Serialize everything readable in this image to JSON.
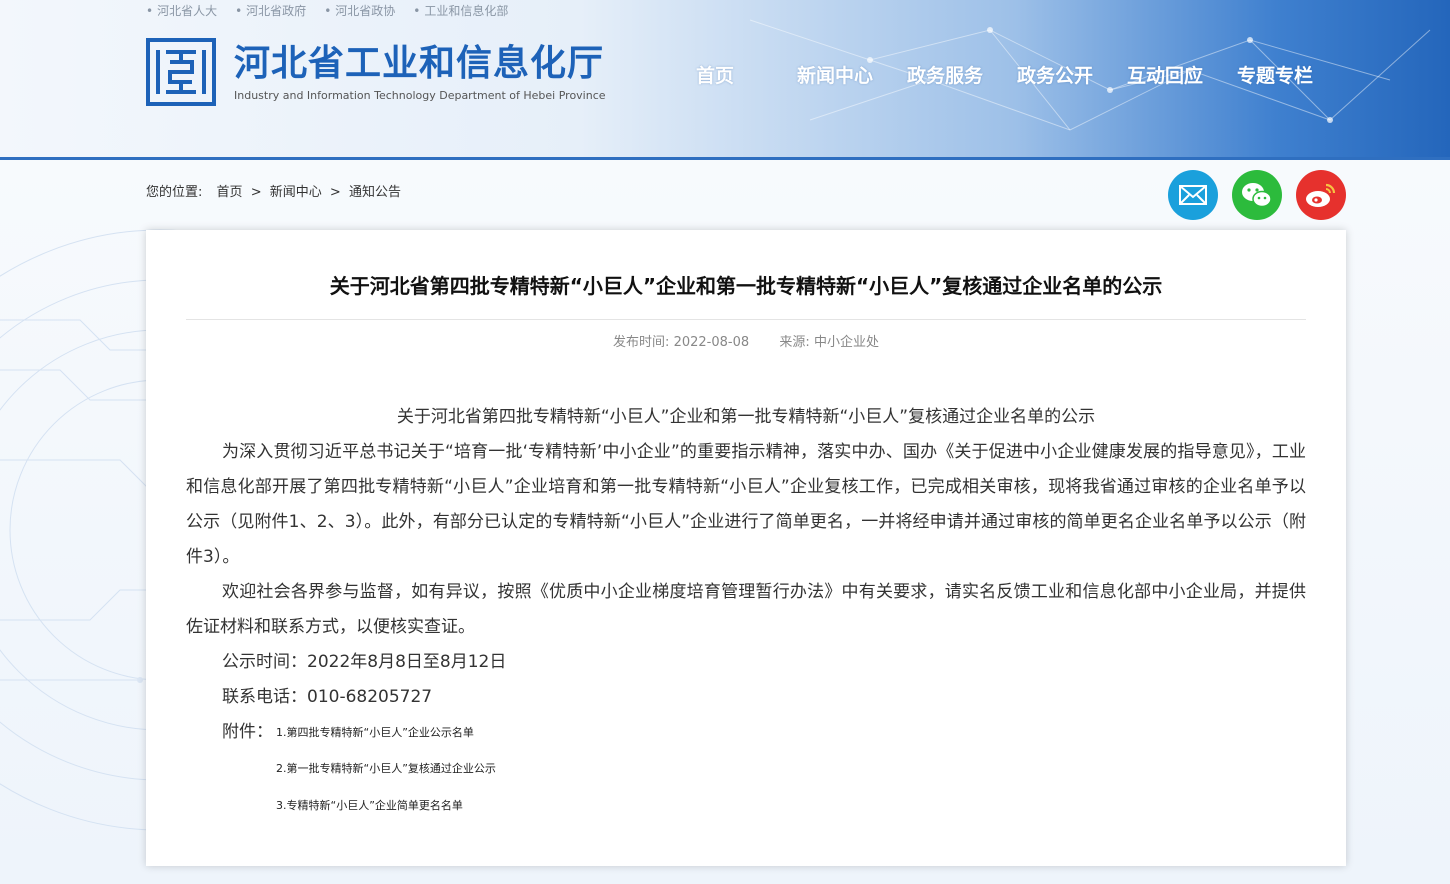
{
  "header": {
    "top_links": [
      "河北省人大",
      "河北省政府",
      "河北省政协",
      "工业和信息化部"
    ],
    "logo_cn": "河北省工业和信息化厅",
    "logo_en": "Industry and Information Technology Department of Hebei Province",
    "nav": [
      "首页",
      "新闻中心",
      "政务服务",
      "政务公开",
      "互动回应",
      "专题专栏"
    ]
  },
  "breadcrumb": {
    "label": "您的位置:",
    "items": [
      "首页",
      "新闻中心",
      "通知公告"
    ],
    "separator": ">"
  },
  "share": {
    "icons": [
      "mail-icon",
      "wechat-icon",
      "weibo-icon"
    ],
    "colors": {
      "mail": "#1aa0dc",
      "wechat": "#2cbb3c",
      "weibo": "#e6312d"
    }
  },
  "article": {
    "title": "关于河北省第四批专精特新“小巨人”企业和第一批专精特新“小巨人”复核通过企业名单的公示",
    "publish_label": "发布时间:",
    "publish_date": "2022-08-08",
    "source_label": "来源:",
    "source": "中小企业处",
    "subtitle": "关于河北省第四批专精特新“小巨人”企业和第一批专精特新“小巨人”复核通过企业名单的公示",
    "para1": "为深入贯彻习近平总书记关于“培育一批‘专精特新’中小企业”的重要指示精神，落实中办、国办《关于促进中小企业健康发展的指导意见》，工业和信息化部开展了第四批专精特新“小巨人”企业培育和第一批专精特新“小巨人”企业复核工作，已完成相关审核，现将我省通过审核的企业名单予以公示（见附件1、2、3）。此外，有部分已认定的专精特新“小巨人”企业进行了简单更名，一并将经申请并通过审核的简单更名企业名单予以公示（附件3）。",
    "para2": "欢迎社会各界参与监督，如有异议，按照《优质中小企业梯度培育管理暂行办法》中有关要求，请实名反馈工业和信息化部中小企业局，并提供佐证材料和联系方式，以便核实查证。",
    "period": "公示时间：2022年8月8日至8月12日",
    "phone": "联系电话：010-68205727",
    "attachments_label": "附件：",
    "attachments": [
      "1.第四批专精特新“小巨人”企业公示名单",
      "2.第一批专精特新“小巨人”复核通过企业公示",
      "3.专精特新“小巨人”企业简单更名名单"
    ]
  }
}
